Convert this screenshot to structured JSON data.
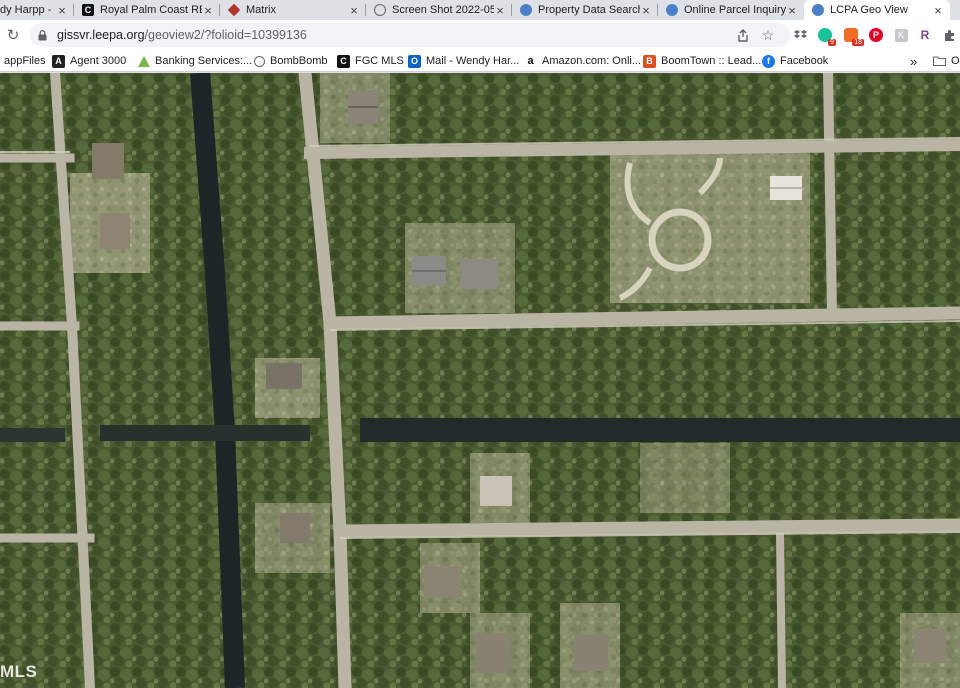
{
  "tabs": [
    {
      "title": "dy Harpp -",
      "icon": "page-icon",
      "active": false
    },
    {
      "title": "Royal Palm Coast RE/",
      "icon": "c-logo-icon",
      "active": false
    },
    {
      "title": "Matrix",
      "icon": "matrix-icon",
      "active": false
    },
    {
      "title": "Screen Shot 2022-05",
      "icon": "globe-icon",
      "active": false
    },
    {
      "title": "Property Data Search",
      "icon": "globe-icon",
      "active": false
    },
    {
      "title": "Online Parcel Inquiry",
      "icon": "globe-icon",
      "active": false
    },
    {
      "title": "LCPA Geo View",
      "icon": "globe-icon",
      "active": true
    }
  ],
  "address_bar": {
    "host": "gissvr.leepa.org",
    "path": "/geoview2/?folioid=10399136"
  },
  "extension_badges": {
    "grammarly": "9",
    "honey": "18"
  },
  "bookmarks": [
    {
      "label": "appFiles",
      "icon": "none"
    },
    {
      "label": "Agent 3000",
      "icon": "a-logo-icon"
    },
    {
      "label": "Banking Services:...",
      "icon": "triangle-icon"
    },
    {
      "label": "BombBomb",
      "icon": "bomb-icon"
    },
    {
      "label": "FGC MLS",
      "icon": "c-logo-icon"
    },
    {
      "label": "Mail - Wendy Har...",
      "icon": "outlook-icon"
    },
    {
      "label": "Amazon.com: Onli...",
      "icon": "amazon-icon"
    },
    {
      "label": "BoomTown :: Lead...",
      "icon": "boomtown-icon"
    },
    {
      "label": "Facebook",
      "icon": "facebook-icon"
    },
    {
      "label": "»",
      "icon": "none"
    },
    {
      "label": "O",
      "icon": "folder-icon"
    }
  ],
  "map": {
    "watermark": "MLS"
  },
  "colors": {
    "vegetation": "#4d5d32",
    "road": "#b8b4a5",
    "canal": "#1f2a2a",
    "sand": "#c9c2a4"
  }
}
